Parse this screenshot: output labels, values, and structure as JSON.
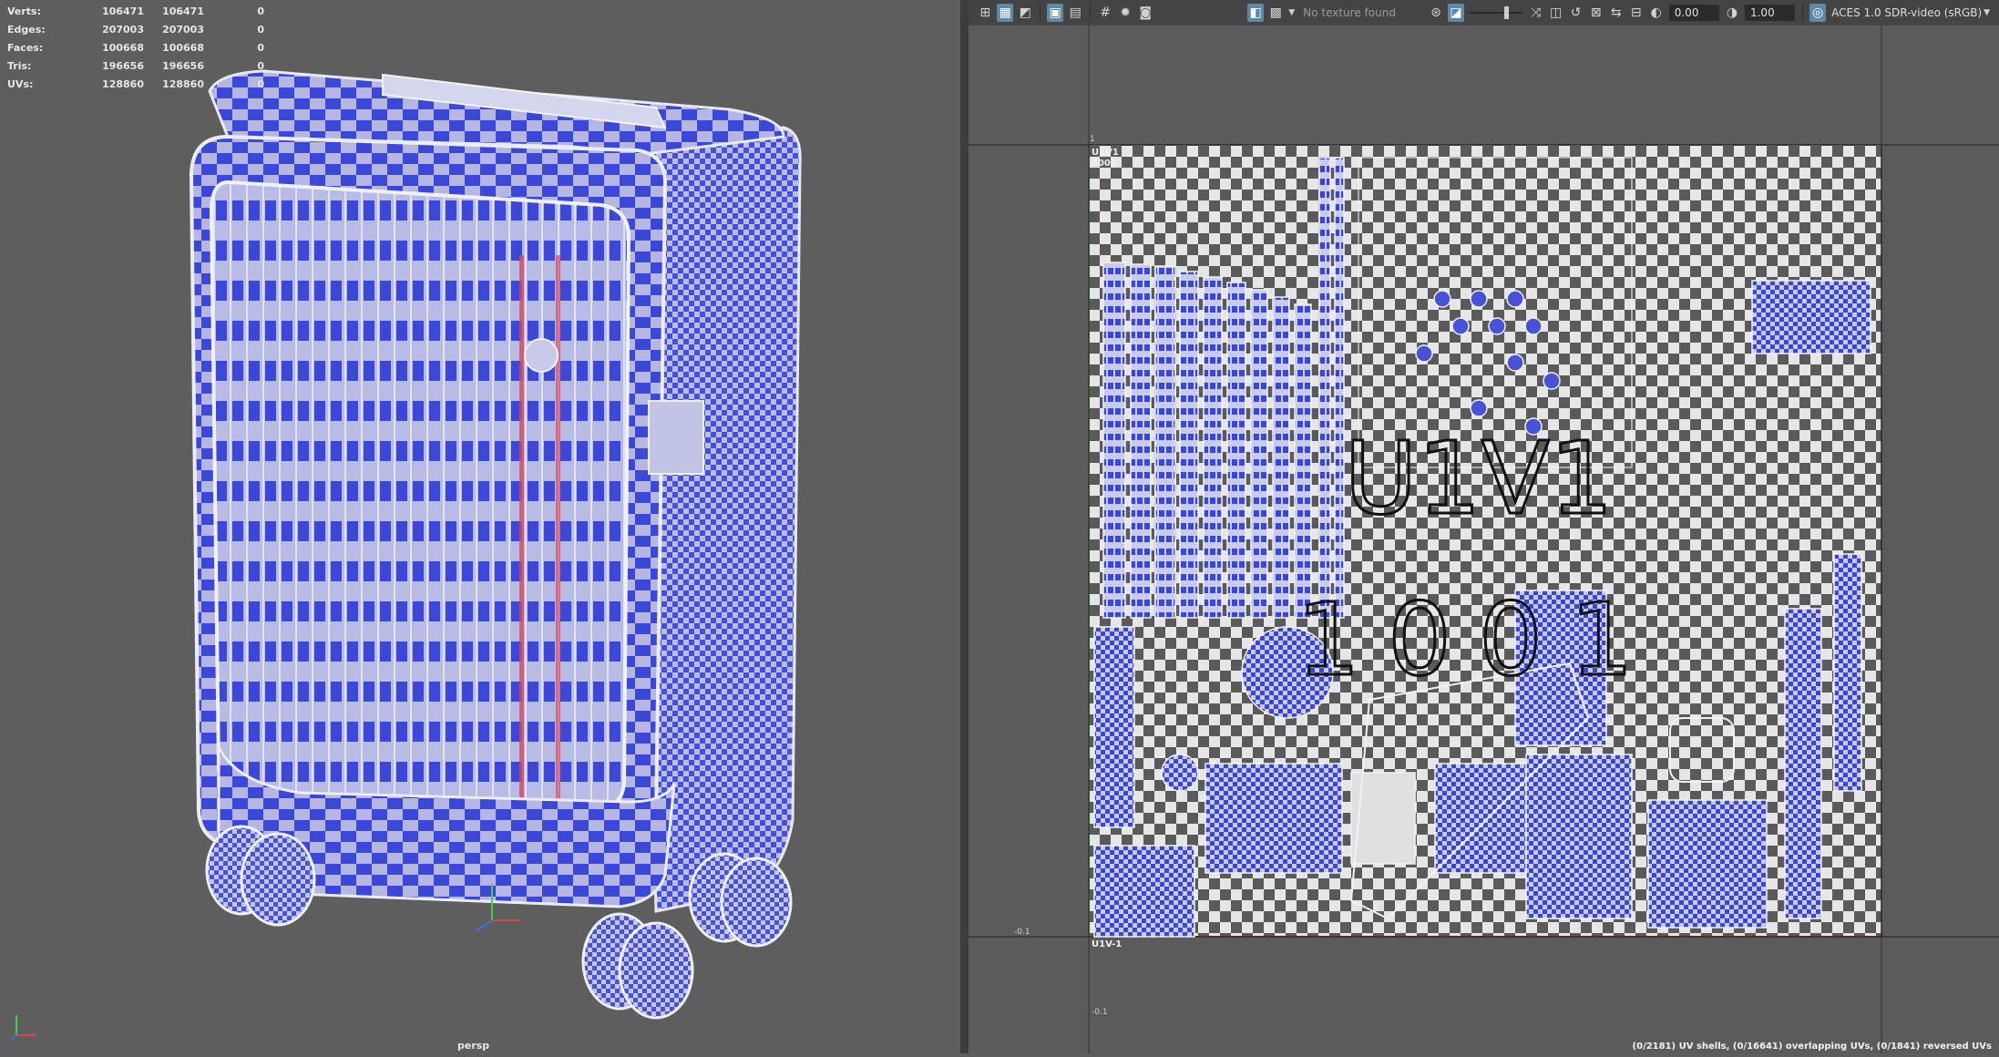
{
  "viewport": {
    "camera_label": "persp",
    "stats": [
      {
        "label": "Verts:",
        "v1": "106471",
        "v2": "106471",
        "v3": "0"
      },
      {
        "label": "Edges:",
        "v1": "207003",
        "v2": "207003",
        "v3": "0"
      },
      {
        "label": "Faces:",
        "v1": "100668",
        "v2": "100668",
        "v3": "0"
      },
      {
        "label": "Tris:",
        "v1": "196656",
        "v2": "196656",
        "v3": "0"
      },
      {
        "label": "UVs:",
        "v1": "128860",
        "v2": "128860",
        "v3": "0"
      }
    ]
  },
  "uv_editor": {
    "toolbar": {
      "texture_status": "No texture found",
      "exposure": "0.00",
      "gamma": "1.00",
      "colorspace": "ACES 1.0 SDR-video (sRGB)"
    },
    "tile_label_top": "U1V1",
    "tile_label_num": "1001",
    "tile_label_bottom": "U1V-1",
    "big_label_line1": "U1V1",
    "big_label_line2": "1001",
    "axis_neg_x": "-0.1",
    "axis_neg_y": "-0.1",
    "axis_one": "1",
    "status": "(0/2181) UV shells, (0/16641) overlapping UVs, (0/1841) reversed UVs"
  },
  "colors": {
    "checker_blue": "#3a46d8",
    "wire_light": "#e4e4ec",
    "seam_red": "#d9485a",
    "background": "#5e5e5e"
  }
}
